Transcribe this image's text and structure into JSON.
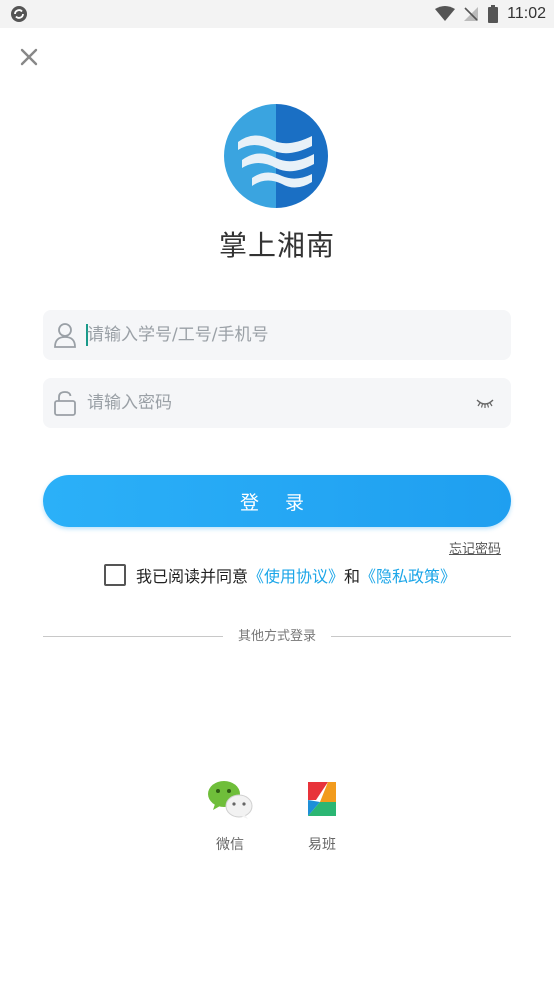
{
  "status_bar": {
    "time": "11:02"
  },
  "app": {
    "title": "掌上湘南"
  },
  "login_form": {
    "username_placeholder": "请输入学号/工号/手机号",
    "password_placeholder": "请输入密码",
    "login_label": "登 录",
    "forgot_password": "忘记密码"
  },
  "agreement": {
    "prefix": "我已阅读并同意",
    "terms": "《使用协议》",
    "conjunction": "和",
    "privacy": "《隐私政策》",
    "checked": false
  },
  "alt_login": {
    "divider_label": "其他方式登录",
    "options": [
      {
        "label": "微信",
        "icon": "wechat-icon"
      },
      {
        "label": "易班",
        "icon": "yiban-icon"
      }
    ]
  },
  "colors": {
    "accent": "#1f9ff0",
    "link": "#1ca6e8"
  }
}
